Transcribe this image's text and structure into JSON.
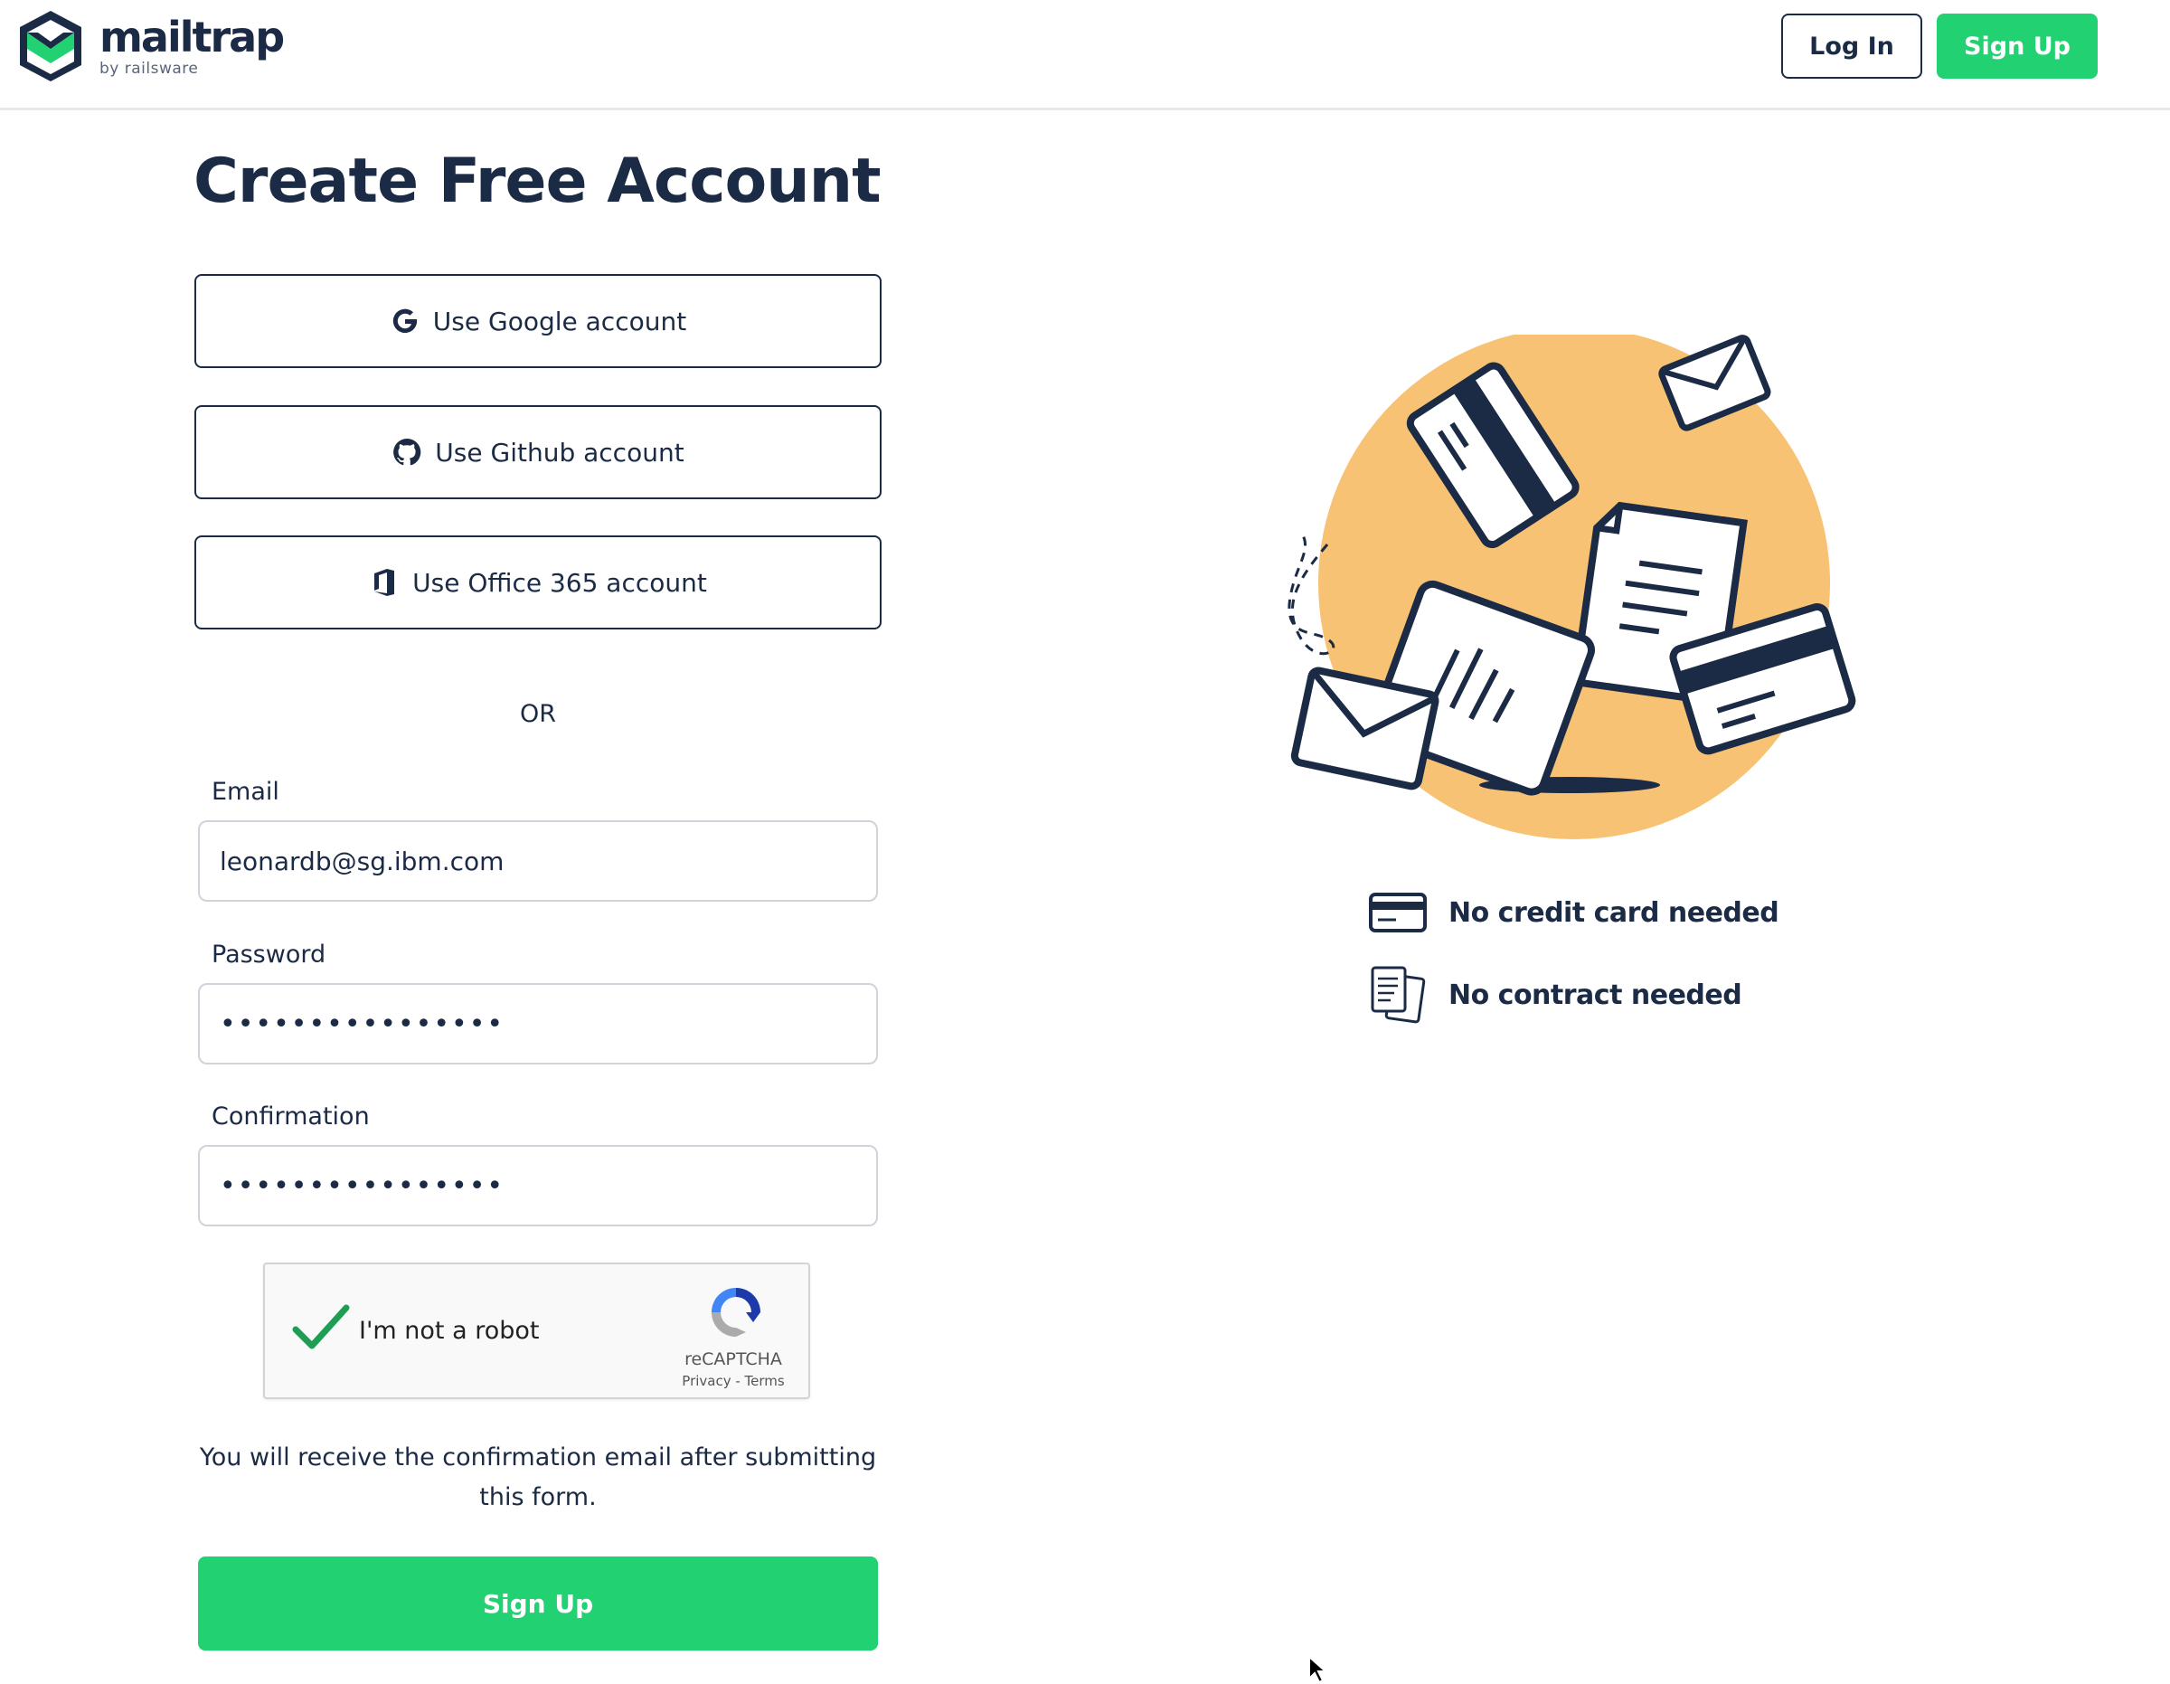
{
  "header": {
    "logo": {
      "name": "mailtrap",
      "sub": "by railsware"
    },
    "login_label": "Log In",
    "signup_label": "Sign Up"
  },
  "page": {
    "title": "Create Free Account"
  },
  "oauth": [
    {
      "label": "Use Google account",
      "icon": "google-icon"
    },
    {
      "label": "Use Github account",
      "icon": "github-icon"
    },
    {
      "label": "Use Office 365 account",
      "icon": "office-icon"
    }
  ],
  "or_label": "OR",
  "form": {
    "email": {
      "label": "Email",
      "value": "leonardb@sg.ibm.com"
    },
    "password": {
      "label": "Password",
      "value": "••••••••••••••••"
    },
    "confirmation": {
      "label": "Confirmation",
      "value": "••••••••••••••••"
    }
  },
  "captcha": {
    "label": "I'm not a robot",
    "brand": "reCAPTCHA",
    "links": "Privacy - Terms",
    "checked": true
  },
  "note": "You will receive the confirmation email after submitting this form.",
  "submit_label": "Sign Up",
  "benefits": [
    {
      "text": "No credit card needed",
      "icon": "credit-card-icon"
    },
    {
      "text": "No contract needed",
      "icon": "documents-icon"
    }
  ],
  "colors": {
    "accent": "#22d172",
    "text": "#1c2b45",
    "illustration_circle": "#f7c274"
  }
}
